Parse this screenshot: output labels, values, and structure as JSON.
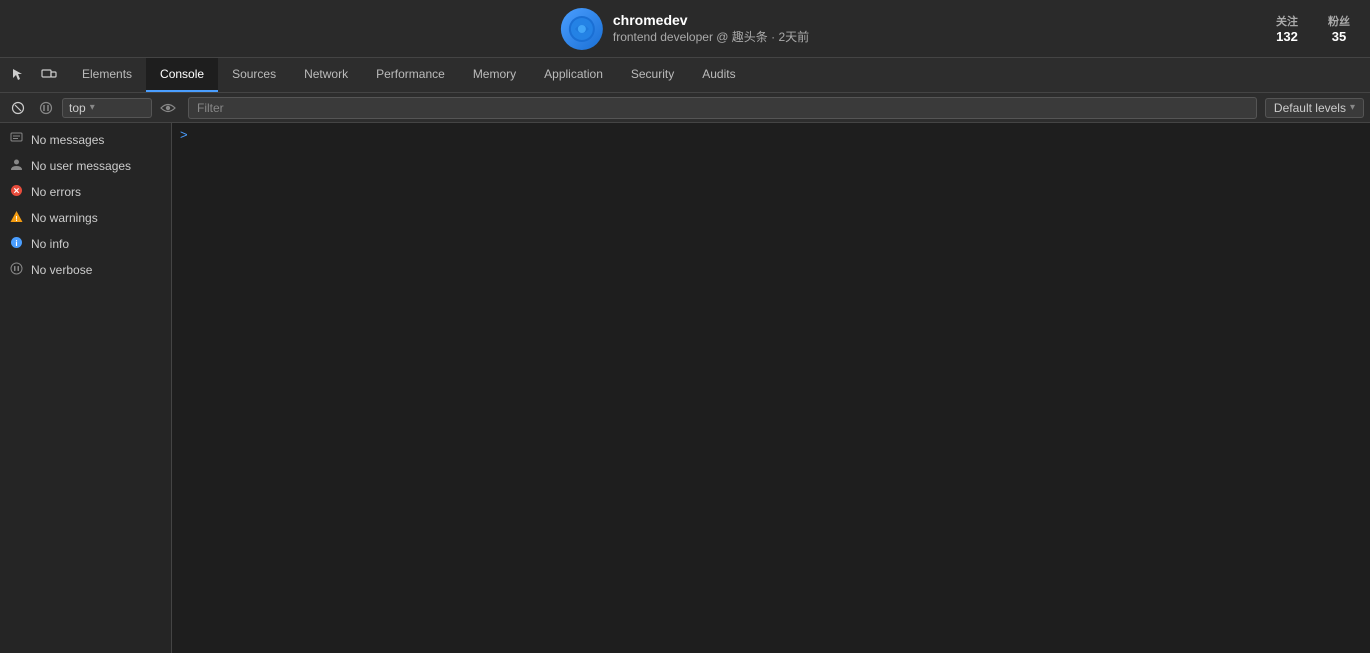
{
  "topbar": {
    "avatar_icon": "🔵",
    "username": "chromedev",
    "subtitle": "frontend developer @ 趣头条 · 2天前",
    "stats": [
      {
        "label": "关注",
        "value": "132"
      },
      {
        "label": "粉丝",
        "value": "35"
      }
    ]
  },
  "devtools": {
    "tabs": [
      {
        "id": "elements",
        "label": "Elements",
        "active": false
      },
      {
        "id": "console",
        "label": "Console",
        "active": true
      },
      {
        "id": "sources",
        "label": "Sources",
        "active": false
      },
      {
        "id": "network",
        "label": "Network",
        "active": false
      },
      {
        "id": "performance",
        "label": "Performance",
        "active": false
      },
      {
        "id": "memory",
        "label": "Memory",
        "active": false
      },
      {
        "id": "application",
        "label": "Application",
        "active": false
      },
      {
        "id": "security",
        "label": "Security",
        "active": false
      },
      {
        "id": "audits",
        "label": "Audits",
        "active": false
      }
    ]
  },
  "toolbar": {
    "context_label": "top",
    "filter_placeholder": "Filter",
    "log_levels_label": "Default levels"
  },
  "sidebar": {
    "items": [
      {
        "id": "messages",
        "icon": "list",
        "label": "No messages"
      },
      {
        "id": "user-messages",
        "icon": "user",
        "label": "No user messages"
      },
      {
        "id": "errors",
        "icon": "error",
        "label": "No errors"
      },
      {
        "id": "warnings",
        "icon": "warning",
        "label": "No warnings"
      },
      {
        "id": "info",
        "icon": "info",
        "label": "No info"
      },
      {
        "id": "verbose",
        "icon": "verbose",
        "label": "No verbose"
      }
    ]
  },
  "console": {
    "prompt_symbol": ">"
  }
}
